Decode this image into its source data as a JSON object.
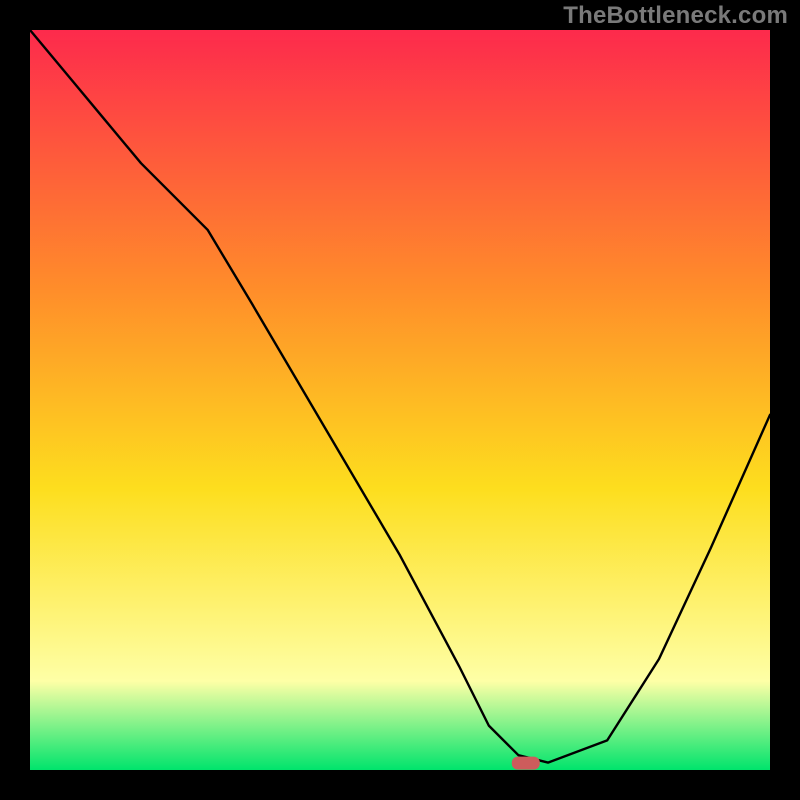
{
  "branding": {
    "watermark": "TheBottleneck.com"
  },
  "colors": {
    "gradient_top": "#fd2a4c",
    "gradient_mid_orange": "#ff8d2a",
    "gradient_yellow": "#fdde1e",
    "gradient_pale_yellow": "#feffa6",
    "gradient_green": "#00e46c",
    "curve": "#000000",
    "marker": "#cd5c5c",
    "frame": "#000000"
  },
  "chart_data": {
    "type": "line",
    "title": "",
    "xlabel": "",
    "ylabel": "",
    "x": [
      0,
      5,
      10,
      15,
      20,
      24,
      30,
      40,
      50,
      58,
      62,
      66,
      70,
      78,
      85,
      92,
      100
    ],
    "values": [
      100,
      94,
      88,
      82,
      77,
      73,
      63,
      46,
      29,
      14,
      6,
      2,
      1,
      4,
      15,
      30,
      48
    ],
    "xlim": [
      0,
      100
    ],
    "ylim": [
      0,
      100
    ],
    "optimum_marker": {
      "x": 67,
      "y": 1
    },
    "grid": false,
    "legend": false
  }
}
